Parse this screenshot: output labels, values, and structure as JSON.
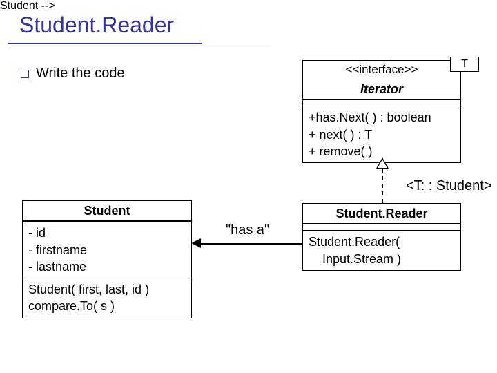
{
  "title": "Student.Reader",
  "bullet": "Write the code",
  "iterator": {
    "stereotype": "<<interface>>",
    "name": "Iterator",
    "param": "T",
    "ops": [
      "+has.Next( ) : boolean",
      "+ next( ) : T",
      "+ remove( )"
    ]
  },
  "binding": "<T: : Student>",
  "student": {
    "name": "Student",
    "attrs": [
      "- id",
      "- firstname",
      "- lastname"
    ],
    "ops": [
      "Student( first, last, id )",
      "compare.To( s )"
    ]
  },
  "reader": {
    "name": "Student.Reader",
    "ops": [
      "Student.Reader(",
      "    Input.Stream )"
    ]
  },
  "assoc_label": "\"has a\""
}
